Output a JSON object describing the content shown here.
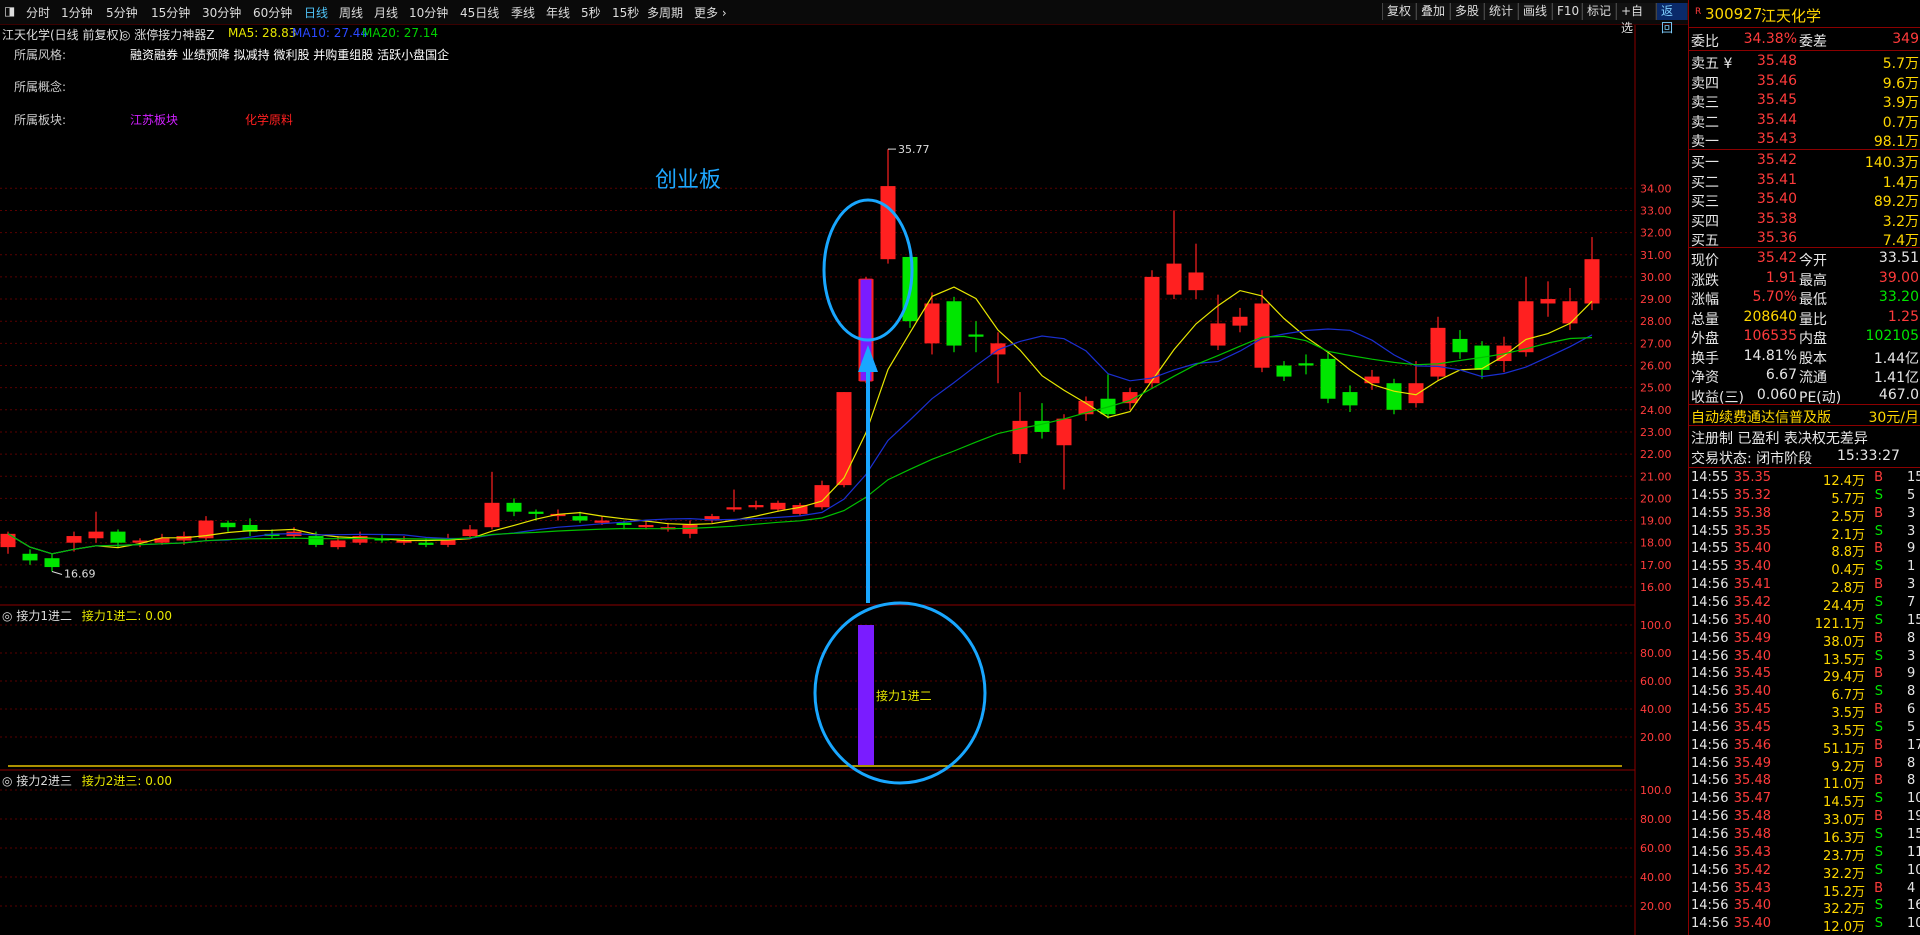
{
  "toolbar": {
    "periods": [
      {
        "label": "分时"
      },
      {
        "label": "1分钟"
      },
      {
        "label": "5分钟"
      },
      {
        "label": "15分钟"
      },
      {
        "label": "30分钟"
      },
      {
        "label": "60分钟"
      },
      {
        "label": "日线",
        "active": true
      },
      {
        "label": "周线"
      },
      {
        "label": "月线"
      },
      {
        "label": "10分钟"
      },
      {
        "label": "45日线"
      },
      {
        "label": "季线"
      },
      {
        "label": "年线"
      },
      {
        "label": "5秒"
      },
      {
        "label": "15秒"
      },
      {
        "label": "多周期"
      },
      {
        "label": "更多"
      }
    ],
    "right_buttons": [
      "复权",
      "叠加",
      "多股",
      "统计",
      "画线",
      "F10",
      "标记",
      "+自选",
      "返回"
    ]
  },
  "info": {
    "title": "江天化学(日线 前复权)",
    "indicator": "涨停接力神器Z",
    "ma5": "MA5: 28.83",
    "ma10": "MA10: 27.44",
    "ma20": "MA20: 27.14",
    "style_label": "所属风格:",
    "style_value": "融资融券 业绩预降 拟减持 微利股 并购重组股 活跃小盘国企",
    "concept_label": "所属概念:",
    "sector_label": "所属板块:",
    "sector1": "江苏板块",
    "sector2": "化学原料",
    "board_note": "创业板",
    "high_mark": "35.77",
    "low_mark": "16.69"
  },
  "sub1": {
    "title": "接力1进二",
    "value_label": "接力1进二: 0.00",
    "annotation": "接力1进二"
  },
  "sub2": {
    "title": "接力2进三",
    "value_label": "接力2进三: 0.00"
  },
  "chart_data": {
    "type": "candlestick",
    "price_axis": {
      "ticks": [
        "34.00",
        "33.00",
        "32.00",
        "31.00",
        "30.00",
        "29.00",
        "28.00",
        "27.00",
        "26.00",
        "25.00",
        "24.00",
        "23.00",
        "22.00",
        "21.00",
        "20.00",
        "19.00",
        "18.00",
        "17.00",
        "16.00"
      ]
    },
    "sub_axis": {
      "ticks": [
        "100.0",
        "80.00",
        "60.00",
        "40.00",
        "20.00"
      ]
    },
    "sub2_axis": {
      "ticks": [
        "100.0",
        "80.00",
        "60.00",
        "40.00",
        "20.00"
      ]
    },
    "candles": [
      {
        "o": 17.8,
        "c": 18.4,
        "h": 18.5,
        "l": 17.5
      },
      {
        "o": 17.5,
        "c": 17.2,
        "h": 17.7,
        "l": 17.0
      },
      {
        "o": 17.3,
        "c": 16.9,
        "h": 17.5,
        "l": 16.7
      },
      {
        "o": 18.0,
        "c": 18.3,
        "h": 18.5,
        "l": 17.6
      },
      {
        "o": 18.2,
        "c": 18.5,
        "h": 19.4,
        "l": 18.0
      },
      {
        "o": 18.5,
        "c": 18.0,
        "h": 18.6,
        "l": 17.8
      },
      {
        "o": 18.0,
        "c": 18.1,
        "h": 18.2,
        "l": 17.8
      },
      {
        "o": 18.0,
        "c": 18.2,
        "h": 18.4,
        "l": 17.9
      },
      {
        "o": 18.1,
        "c": 18.3,
        "h": 18.5,
        "l": 17.9
      },
      {
        "o": 18.2,
        "c": 19.0,
        "h": 19.2,
        "l": 18.1
      },
      {
        "o": 18.9,
        "c": 18.7,
        "h": 19.0,
        "l": 18.5
      },
      {
        "o": 18.8,
        "c": 18.5,
        "h": 19.1,
        "l": 18.3
      },
      {
        "o": 18.4,
        "c": 18.3,
        "h": 18.6,
        "l": 18.2
      },
      {
        "o": 18.3,
        "c": 18.5,
        "h": 18.7,
        "l": 18.2
      },
      {
        "o": 18.3,
        "c": 17.9,
        "h": 18.5,
        "l": 17.8
      },
      {
        "o": 17.8,
        "c": 18.1,
        "h": 18.3,
        "l": 17.7
      },
      {
        "o": 18.0,
        "c": 18.3,
        "h": 18.5,
        "l": 17.9
      },
      {
        "o": 18.2,
        "c": 18.1,
        "h": 18.4,
        "l": 18.0
      },
      {
        "o": 18.0,
        "c": 18.1,
        "h": 18.3,
        "l": 17.9
      },
      {
        "o": 18.0,
        "c": 17.9,
        "h": 18.2,
        "l": 17.8
      },
      {
        "o": 17.9,
        "c": 18.2,
        "h": 18.4,
        "l": 17.8
      },
      {
        "o": 18.3,
        "c": 18.6,
        "h": 18.8,
        "l": 18.2
      },
      {
        "o": 18.7,
        "c": 19.8,
        "h": 21.2,
        "l": 18.6
      },
      {
        "o": 19.8,
        "c": 19.4,
        "h": 20.0,
        "l": 19.2
      },
      {
        "o": 19.4,
        "c": 19.3,
        "h": 19.5,
        "l": 19.0
      },
      {
        "o": 19.2,
        "c": 19.3,
        "h": 19.5,
        "l": 19.0
      },
      {
        "o": 19.2,
        "c": 19.0,
        "h": 19.4,
        "l": 18.9
      },
      {
        "o": 18.9,
        "c": 19.0,
        "h": 19.2,
        "l": 18.8
      },
      {
        "o": 18.9,
        "c": 18.8,
        "h": 19.0,
        "l": 18.6
      },
      {
        "o": 18.7,
        "c": 18.8,
        "h": 19.0,
        "l": 18.6
      },
      {
        "o": 18.6,
        "c": 18.7,
        "h": 18.9,
        "l": 18.5
      },
      {
        "o": 18.4,
        "c": 18.8,
        "h": 19.0,
        "l": 18.2
      },
      {
        "o": 19.0,
        "c": 19.2,
        "h": 19.3,
        "l": 18.9
      },
      {
        "o": 19.5,
        "c": 19.6,
        "h": 20.4,
        "l": 19.4
      },
      {
        "o": 19.6,
        "c": 19.7,
        "h": 19.9,
        "l": 19.5
      },
      {
        "o": 19.5,
        "c": 19.8,
        "h": 19.9,
        "l": 19.4
      },
      {
        "o": 19.3,
        "c": 19.7,
        "h": 19.8,
        "l": 19.2
      },
      {
        "o": 19.6,
        "c": 20.6,
        "h": 20.8,
        "l": 19.5
      },
      {
        "o": 20.6,
        "c": 24.8,
        "h": 24.8,
        "l": 20.5
      },
      {
        "o": 25.3,
        "c": 29.9,
        "h": 30.0,
        "l": 25.2
      },
      {
        "o": 30.8,
        "c": 34.1,
        "h": 35.77,
        "l": 30.6
      },
      {
        "o": 30.9,
        "c": 28.0,
        "h": 31.3,
        "l": 27.7
      },
      {
        "o": 27.0,
        "c": 28.8,
        "h": 29.3,
        "l": 26.5
      },
      {
        "o": 28.9,
        "c": 26.9,
        "h": 29.1,
        "l": 26.6
      },
      {
        "o": 27.4,
        "c": 27.3,
        "h": 28.0,
        "l": 26.6
      },
      {
        "o": 26.5,
        "c": 27.0,
        "h": 27.5,
        "l": 25.2
      },
      {
        "o": 22.0,
        "c": 23.5,
        "h": 24.8,
        "l": 21.6
      },
      {
        "o": 23.5,
        "c": 23.0,
        "h": 24.3,
        "l": 22.7
      },
      {
        "o": 22.4,
        "c": 23.6,
        "h": 23.8,
        "l": 20.4
      },
      {
        "o": 23.8,
        "c": 24.4,
        "h": 24.6,
        "l": 23.5
      },
      {
        "o": 24.5,
        "c": 23.8,
        "h": 25.6,
        "l": 23.6
      },
      {
        "o": 24.3,
        "c": 24.8,
        "h": 25.0,
        "l": 24.0
      },
      {
        "o": 25.2,
        "c": 30.0,
        "h": 30.3,
        "l": 25.0
      },
      {
        "o": 29.2,
        "c": 30.6,
        "h": 33.0,
        "l": 29.0
      },
      {
        "o": 29.4,
        "c": 30.2,
        "h": 31.5,
        "l": 29.0
      },
      {
        "o": 26.9,
        "c": 27.9,
        "h": 29.2,
        "l": 26.7
      },
      {
        "o": 27.8,
        "c": 28.2,
        "h": 28.6,
        "l": 27.5
      },
      {
        "o": 25.9,
        "c": 28.8,
        "h": 29.4,
        "l": 25.7
      },
      {
        "o": 26.0,
        "c": 25.5,
        "h": 26.2,
        "l": 25.3
      },
      {
        "o": 26.1,
        "c": 26.0,
        "h": 26.5,
        "l": 25.6
      },
      {
        "o": 26.3,
        "c": 24.5,
        "h": 26.6,
        "l": 24.3
      },
      {
        "o": 24.8,
        "c": 24.2,
        "h": 25.1,
        "l": 23.9
      },
      {
        "o": 25.2,
        "c": 25.5,
        "h": 25.8,
        "l": 24.9
      },
      {
        "o": 25.2,
        "c": 24.0,
        "h": 25.4,
        "l": 23.8
      },
      {
        "o": 24.3,
        "c": 25.2,
        "h": 26.2,
        "l": 24.1
      },
      {
        "o": 25.5,
        "c": 27.7,
        "h": 28.2,
        "l": 25.3
      },
      {
        "o": 27.2,
        "c": 26.6,
        "h": 27.6,
        "l": 26.3
      },
      {
        "o": 26.9,
        "c": 25.8,
        "h": 27.1,
        "l": 25.4
      },
      {
        "o": 26.2,
        "c": 26.9,
        "h": 27.3,
        "l": 25.7
      },
      {
        "o": 26.6,
        "c": 28.9,
        "h": 30.0,
        "l": 26.4
      },
      {
        "o": 28.8,
        "c": 29.0,
        "h": 29.8,
        "l": 28.2
      },
      {
        "o": 27.9,
        "c": 28.9,
        "h": 29.5,
        "l": 27.6
      },
      {
        "o": 28.8,
        "c": 30.8,
        "h": 31.8,
        "l": 28.5
      }
    ]
  },
  "panel": {
    "code": "300927",
    "name": "江天化学",
    "wb_label": "委比",
    "wb_value": "34.38%",
    "wc_label": "委差",
    "wc_value": "349",
    "asks": [
      {
        "label": "卖五",
        "flag": "¥",
        "price": "35.48",
        "vol": "5.7万"
      },
      {
        "label": "卖四",
        "price": "35.46",
        "vol": "9.6万"
      },
      {
        "label": "卖三",
        "price": "35.45",
        "vol": "3.9万"
      },
      {
        "label": "卖二",
        "price": "35.44",
        "vol": "0.7万"
      },
      {
        "label": "卖一",
        "price": "35.43",
        "vol": "98.1万"
      }
    ],
    "bids": [
      {
        "label": "买一",
        "price": "35.42",
        "vol": "140.3万"
      },
      {
        "label": "买二",
        "price": "35.41",
        "vol": "1.4万"
      },
      {
        "label": "买三",
        "price": "35.40",
        "vol": "89.2万"
      },
      {
        "label": "买四",
        "price": "35.38",
        "vol": "3.2万"
      },
      {
        "label": "买五",
        "price": "35.36",
        "vol": "7.4万"
      }
    ],
    "quote": [
      {
        "l1": "现价",
        "v1": "35.42",
        "c1": "red",
        "l2": "今开",
        "v2": "33.51",
        "c2": "white"
      },
      {
        "l1": "涨跌",
        "v1": "1.91",
        "c1": "red",
        "l2": "最高",
        "v2": "39.00",
        "c2": "red"
      },
      {
        "l1": "涨幅",
        "v1": "5.70%",
        "c1": "red",
        "l2": "最低",
        "v2": "33.20",
        "c2": "green"
      },
      {
        "l1": "总量",
        "v1": "208640",
        "c1": "yellow",
        "l2": "量比",
        "v2": "1.25",
        "c2": "red"
      },
      {
        "l1": "外盘",
        "v1": "106535",
        "c1": "red",
        "l2": "内盘",
        "v2": "102105",
        "c2": "green"
      },
      {
        "l1": "换手",
        "v1": "14.81%",
        "c1": "white",
        "l2": "股本",
        "v2": "1.44亿",
        "c2": "white"
      },
      {
        "l1": "净资",
        "v1": "6.67",
        "c1": "white",
        "l2": "流通",
        "v2": "1.41亿",
        "c2": "white"
      },
      {
        "l1": "收益(三)",
        "v1": "0.060",
        "c1": "white",
        "l2": "PE(动)",
        "v2": "467.0",
        "c2": "white"
      }
    ],
    "ad1": "自动续费通达信普及版",
    "ad1_price": "30元/月",
    "ad2": "注册制 已盈利 表决权无差异",
    "status_label": "交易状态: 闭市阶段",
    "status_time": "15:33:27",
    "ticks": [
      {
        "t": "14:55",
        "p": "35.35",
        "v": "12.4万",
        "bs": "B",
        "n": "15"
      },
      {
        "t": "14:55",
        "p": "35.32",
        "v": "5.7万",
        "bs": "S",
        "n": "5"
      },
      {
        "t": "14:55",
        "p": "35.38",
        "v": "2.5万",
        "bs": "B",
        "n": "3"
      },
      {
        "t": "14:55",
        "p": "35.35",
        "v": "2.1万",
        "bs": "S",
        "n": "3"
      },
      {
        "t": "14:55",
        "p": "35.40",
        "v": "8.8万",
        "bs": "B",
        "n": "9"
      },
      {
        "t": "14:55",
        "p": "35.40",
        "v": "0.4万",
        "bs": "S",
        "n": "1"
      },
      {
        "t": "14:56",
        "p": "35.41",
        "v": "2.8万",
        "bs": "B",
        "n": "3"
      },
      {
        "t": "14:56",
        "p": "35.42",
        "v": "24.4万",
        "bs": "S",
        "n": "7"
      },
      {
        "t": "14:56",
        "p": "35.40",
        "v": "121.1万",
        "bs": "S",
        "n": "15"
      },
      {
        "t": "14:56",
        "p": "35.49",
        "v": "38.0万",
        "bs": "B",
        "n": "8"
      },
      {
        "t": "14:56",
        "p": "35.40",
        "v": "13.5万",
        "bs": "S",
        "n": "3"
      },
      {
        "t": "14:56",
        "p": "35.45",
        "v": "29.4万",
        "bs": "B",
        "n": "9"
      },
      {
        "t": "14:56",
        "p": "35.40",
        "v": "6.7万",
        "bs": "S",
        "n": "8"
      },
      {
        "t": "14:56",
        "p": "35.45",
        "v": "3.5万",
        "bs": "B",
        "n": "6"
      },
      {
        "t": "14:56",
        "p": "35.45",
        "v": "3.5万",
        "bs": "S",
        "n": "5"
      },
      {
        "t": "14:56",
        "p": "35.46",
        "v": "51.1万",
        "bs": "B",
        "n": "17"
      },
      {
        "t": "14:56",
        "p": "35.49",
        "v": "9.2万",
        "bs": "B",
        "n": "8"
      },
      {
        "t": "14:56",
        "p": "35.48",
        "v": "11.0万",
        "bs": "B",
        "n": "8"
      },
      {
        "t": "14:56",
        "p": "35.47",
        "v": "14.5万",
        "bs": "S",
        "n": "10"
      },
      {
        "t": "14:56",
        "p": "35.48",
        "v": "33.0万",
        "bs": "B",
        "n": "19"
      },
      {
        "t": "14:56",
        "p": "35.48",
        "v": "16.3万",
        "bs": "S",
        "n": "15"
      },
      {
        "t": "14:56",
        "p": "35.43",
        "v": "23.7万",
        "bs": "S",
        "n": "11"
      },
      {
        "t": "14:56",
        "p": "35.42",
        "v": "32.2万",
        "bs": "S",
        "n": "10"
      },
      {
        "t": "14:56",
        "p": "35.43",
        "v": "15.2万",
        "bs": "B",
        "n": "4"
      },
      {
        "t": "14:56",
        "p": "35.40",
        "v": "32.2万",
        "bs": "S",
        "n": "16"
      },
      {
        "t": "14:56",
        "p": "35.40",
        "v": "12.0万",
        "bs": "S",
        "n": "10"
      }
    ]
  },
  "colors": {
    "up": "#ff2020",
    "down": "#00e600",
    "ma5": "#e6e600",
    "ma10": "#1a2fd0",
    "ma20": "#00c000",
    "signal": "#7a1cff",
    "annot": "#19a7ff",
    "grid": "#5a0000"
  }
}
